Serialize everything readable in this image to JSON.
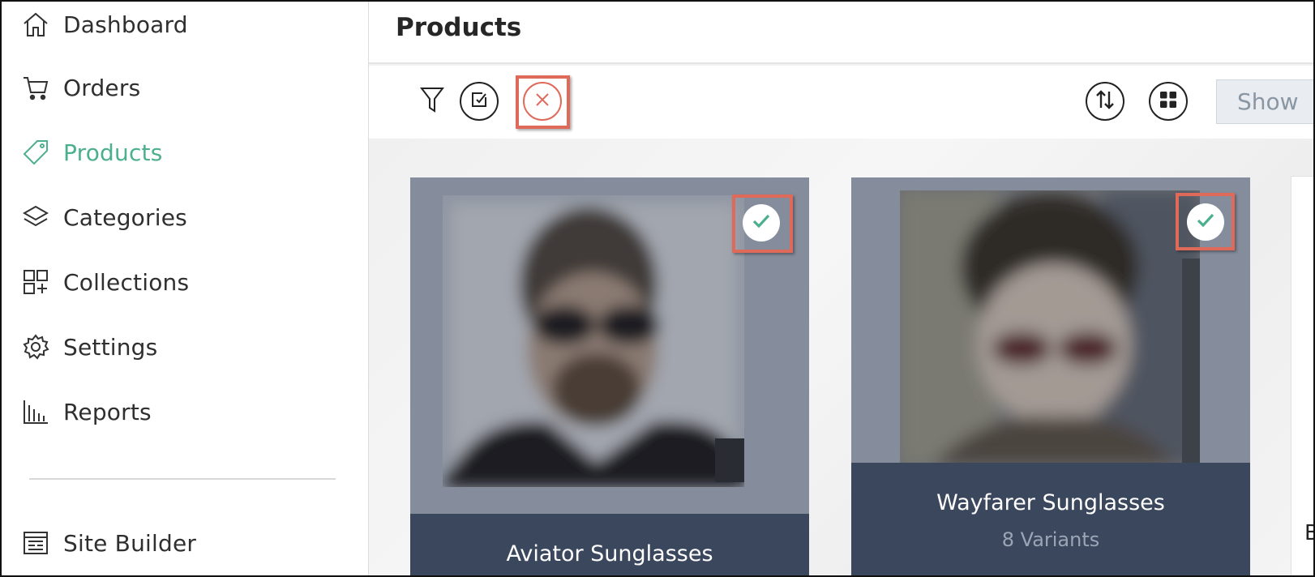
{
  "sidebar": {
    "items": [
      {
        "label": "Dashboard",
        "icon": "home-icon",
        "active": false
      },
      {
        "label": "Orders",
        "icon": "cart-icon",
        "active": false
      },
      {
        "label": "Products",
        "icon": "tag-icon",
        "active": true
      },
      {
        "label": "Categories",
        "icon": "layers-icon",
        "active": false
      },
      {
        "label": "Collections",
        "icon": "collections-icon",
        "active": false
      },
      {
        "label": "Settings",
        "icon": "gear-icon",
        "active": false
      },
      {
        "label": "Reports",
        "icon": "bar-chart-icon",
        "active": false
      }
    ],
    "bottom_item": {
      "label": "Site Builder",
      "icon": "site-builder-icon"
    }
  },
  "header": {
    "title": "Products"
  },
  "toolbar": {
    "filter_icon": "filter-icon",
    "select_icon": "select-all-icon",
    "clear_icon": "close-circle-icon",
    "sort_icon": "sort-icon",
    "grid_icon": "grid-view-icon",
    "show_label": "Show"
  },
  "products": [
    {
      "name": "Aviator Sunglasses",
      "variants": "",
      "selected": true
    },
    {
      "name": "Wayfarer Sunglasses",
      "variants": "8 Variants",
      "selected": true
    }
  ],
  "peek_card": {
    "text": "B"
  },
  "colors": {
    "accent": "#4caf8e",
    "highlight": "#e06a5a",
    "card_footer": "#3a475c",
    "card_image_bg": "#858c9b"
  }
}
